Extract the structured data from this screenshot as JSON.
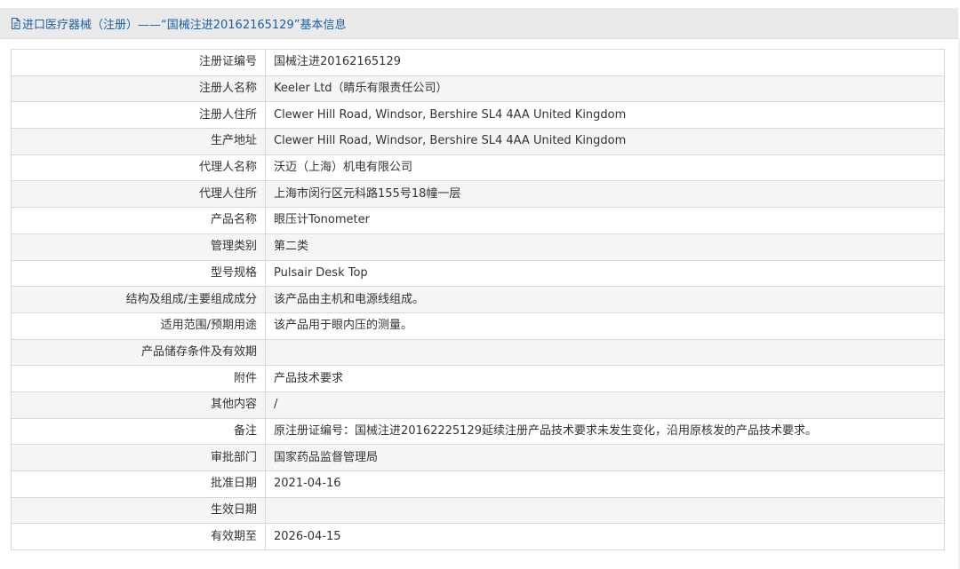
{
  "header": {
    "title": "进口医疗器械（注册）——“国械注进20162165129”基本信息",
    "icon": "document-icon"
  },
  "rows": [
    {
      "label": "注册证编号",
      "value": "国械注进20162165129"
    },
    {
      "label": "注册人名称",
      "value": "Keeler Ltd（睛乐有限责任公司）"
    },
    {
      "label": "注册人住所",
      "value": "Clewer Hill Road, Windsor, Bershire SL4 4AA United Kingdom"
    },
    {
      "label": "生产地址",
      "value": "Clewer Hill Road, Windsor, Bershire SL4 4AA United Kingdom"
    },
    {
      "label": "代理人名称",
      "value": "沃迈（上海）机电有限公司"
    },
    {
      "label": "代理人住所",
      "value": "上海市闵行区元科路155号18幢一层"
    },
    {
      "label": "产品名称",
      "value": "眼压计Tonometer"
    },
    {
      "label": "管理类别",
      "value": "第二类"
    },
    {
      "label": "型号规格",
      "value": "Pulsair Desk Top"
    },
    {
      "label": "结构及组成/主要组成成分",
      "value": "该产品由主机和电源线组成。"
    },
    {
      "label": "适用范围/预期用途",
      "value": "该产品用于眼内压的测量。"
    },
    {
      "label": "产品储存条件及有效期",
      "value": ""
    },
    {
      "label": "附件",
      "value": "产品技术要求"
    },
    {
      "label": "其他内容",
      "value": "/"
    },
    {
      "label": "备注",
      "value": "原注册证编号：国械注进20162225129延续注册产品技术要求未发生变化，沿用原核发的产品技术要求。"
    },
    {
      "label": "审批部门",
      "value": "国家药品监督管理局"
    },
    {
      "label": "批准日期",
      "value": "2021-04-16"
    },
    {
      "label": "生效日期",
      "value": ""
    },
    {
      "label": "有效期至",
      "value": "2026-04-15"
    }
  ],
  "colors": {
    "header_bg": "#eaeaea",
    "title_color": "#1a5fa8",
    "border": "#d9d9d9",
    "stripe": "#f5f5f5"
  }
}
